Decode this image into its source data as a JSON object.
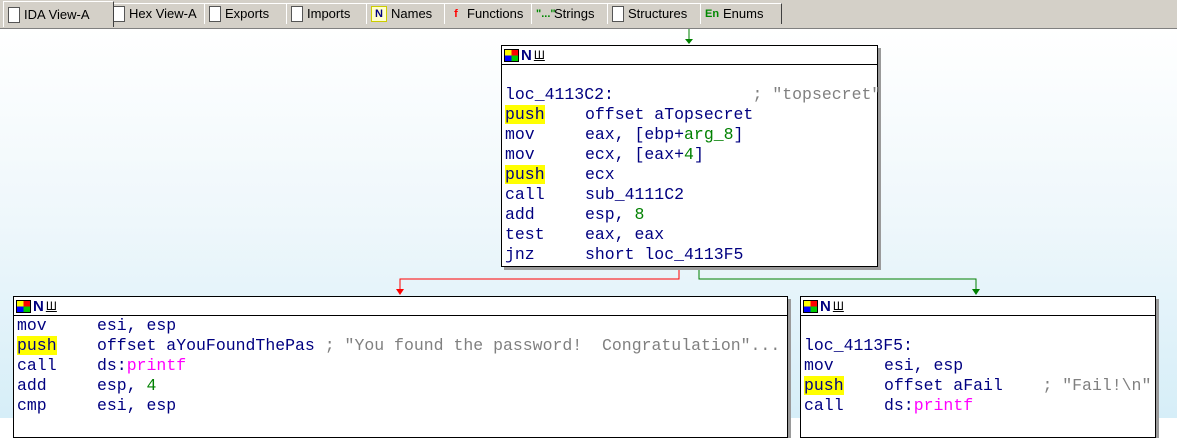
{
  "tabs": [
    {
      "label": "IDA View-A",
      "icon": "ida-view-icon",
      "active": true
    },
    {
      "label": "Hex View-A",
      "icon": "hex-view-icon"
    },
    {
      "label": "Exports",
      "icon": "exports-icon"
    },
    {
      "label": "Imports",
      "icon": "imports-icon"
    },
    {
      "label": "Names",
      "icon": "names-icon",
      "glyph": "N"
    },
    {
      "label": "Functions",
      "icon": "functions-icon",
      "glyph": "f"
    },
    {
      "label": "Strings",
      "icon": "strings-icon",
      "glyph": "\"...\""
    },
    {
      "label": "Structures",
      "icon": "structures-icon"
    },
    {
      "label": "Enums",
      "icon": "enums-icon",
      "glyph": "En"
    }
  ],
  "header_icons": {
    "n": "N",
    "u": "Ш"
  },
  "colors": {
    "true_edge": "#008000",
    "false_edge": "#ff0000",
    "highlight": "#ffff00"
  },
  "blocks": {
    "top": {
      "label": "loc_4113C2:",
      "label_comment": "; \"topsecret\"",
      "lines": [
        {
          "m": "push",
          "hl": true,
          "o": "offset aTopsecret"
        },
        {
          "m": "mov",
          "o": "eax, [ebp+",
          "g": "arg_8",
          "t": "]"
        },
        {
          "m": "mov",
          "o": "ecx, [eax+",
          "g": "4",
          "t": "]"
        },
        {
          "m": "push",
          "hl": true,
          "o": "ecx"
        },
        {
          "m": "call",
          "o": "sub_4111C2"
        },
        {
          "m": "add",
          "o": "esp, ",
          "g": "8"
        },
        {
          "m": "test",
          "o": "eax, eax"
        },
        {
          "m": "jnz",
          "o": "short loc_4113F5"
        }
      ]
    },
    "left": {
      "lines": [
        {
          "m": "mov",
          "o": "esi, esp"
        },
        {
          "m": "push",
          "hl": true,
          "o": "offset aYouFoundThePas ",
          "c": "; \"You found the password!  Congratulation\"..."
        },
        {
          "m": "call",
          "o": "ds:",
          "f": "printf"
        },
        {
          "m": "add",
          "o": "esp, ",
          "g": "4"
        },
        {
          "m": "cmp",
          "o": "esi, esp"
        }
      ]
    },
    "right": {
      "label": "loc_4113F5:",
      "lines": [
        {
          "m": "mov",
          "o": "esi, esp"
        },
        {
          "m": "push",
          "hl": true,
          "o": "offset aFail    ",
          "c": "; \"Fail!\\n\""
        },
        {
          "m": "call",
          "o": "ds:",
          "f": "printf"
        }
      ]
    }
  }
}
